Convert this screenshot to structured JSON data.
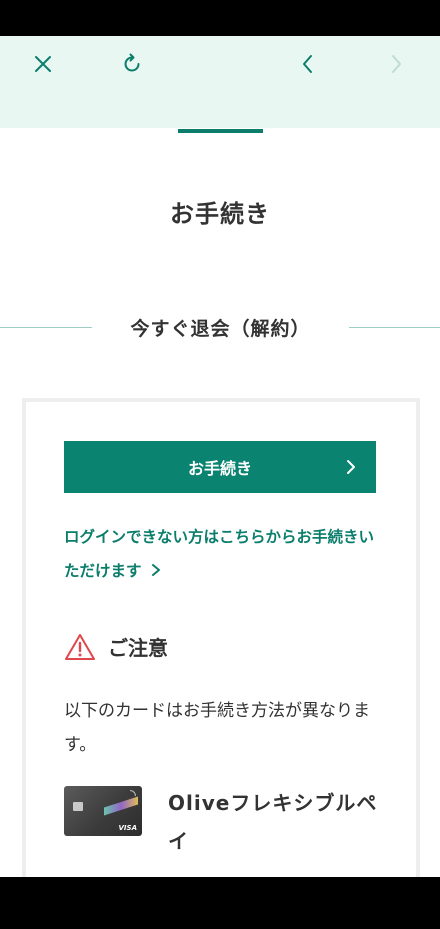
{
  "toolbar": {
    "close_icon": "close-icon",
    "reload_icon": "reload-icon",
    "back_icon": "chevron-left-icon",
    "forward_icon": "chevron-right-icon"
  },
  "page": {
    "title": "お手続き",
    "section_heading": "今すぐ退会（解約）"
  },
  "panel": {
    "button_label": "お手続き",
    "login_link": "ログインできない方はこちらからお手続きいただけます",
    "caution_title": "ご注意",
    "description": "以下のカードはお手続き方法が異なります。",
    "card_name": "Oliveフレキシブルペイ",
    "card_brand": "VISA"
  },
  "colors": {
    "accent": "#0a8370",
    "toolbar_bg": "#e9f7f2",
    "warning": "#e0474c"
  }
}
